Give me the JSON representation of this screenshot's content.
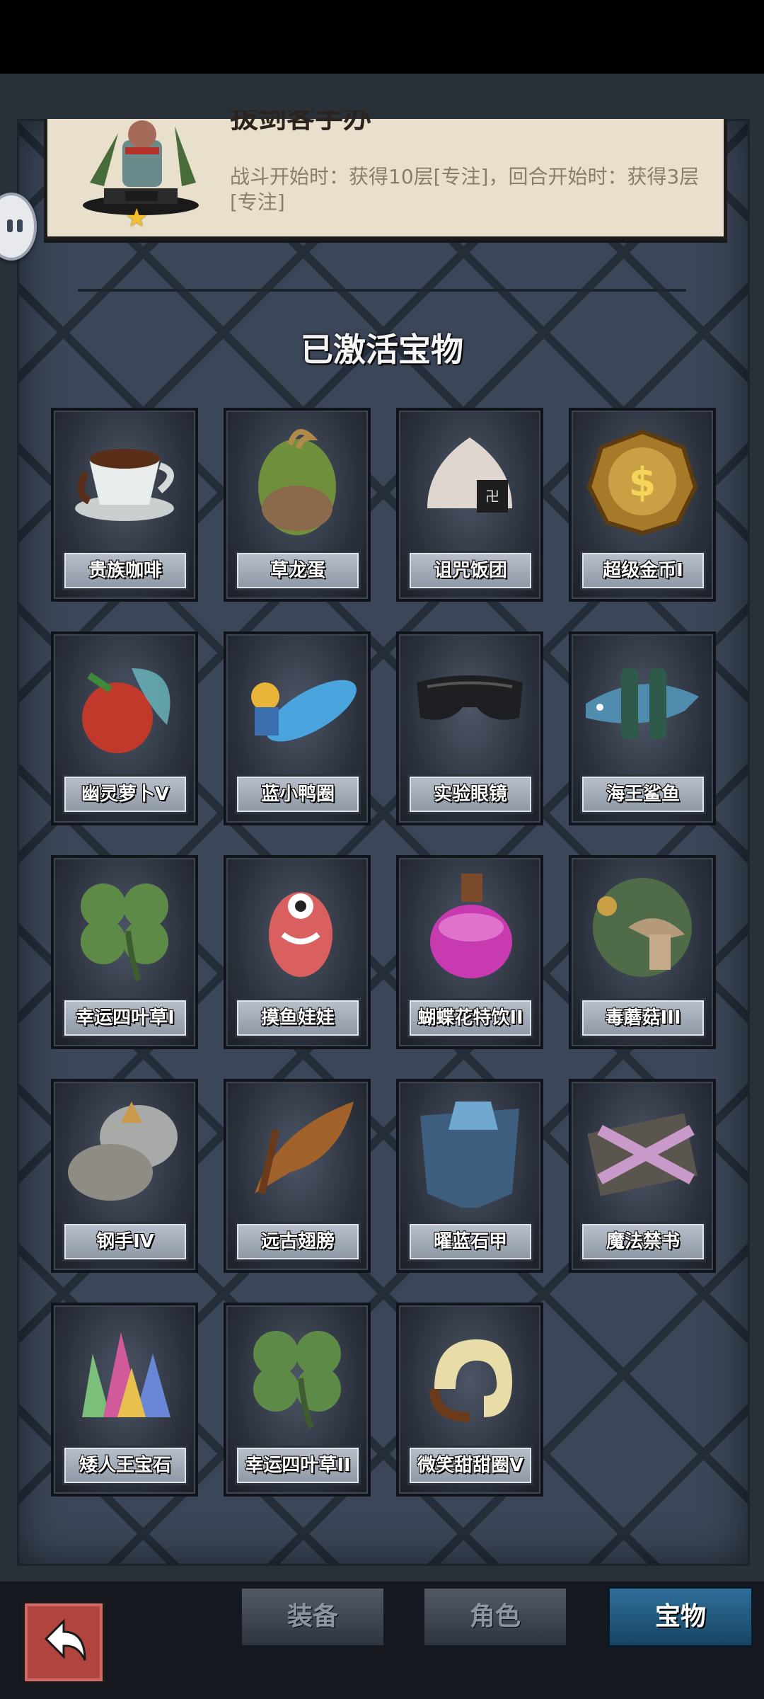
{
  "card": {
    "title": "拔剑客手办",
    "description": "战斗开始时：获得10层[专注]，回合开始时：获得3层[专注]"
  },
  "section_title": "已激活宝物",
  "treasures": [
    {
      "name": "贵族咖啡",
      "icon": "coffee-cup-icon"
    },
    {
      "name": "草龙蛋",
      "icon": "dragon-egg-icon"
    },
    {
      "name": "诅咒饭团",
      "icon": "rice-ball-icon"
    },
    {
      "name": "超级金币I",
      "icon": "gold-coin-icon"
    },
    {
      "name": "幽灵萝卜V",
      "icon": "ghost-radish-icon"
    },
    {
      "name": "蓝小鸭圈",
      "icon": "duck-ring-icon"
    },
    {
      "name": "实验眼镜",
      "icon": "goggles-icon"
    },
    {
      "name": "海王鲨鱼",
      "icon": "shark-icon"
    },
    {
      "name": "幸运四叶草I",
      "icon": "clover-icon"
    },
    {
      "name": "摸鱼娃娃",
      "icon": "doll-icon"
    },
    {
      "name": "蝴蝶花特饮II",
      "icon": "potion-icon"
    },
    {
      "name": "毒蘑菇III",
      "icon": "mushroom-icon"
    },
    {
      "name": "钢手IV",
      "icon": "steel-gauntlet-icon"
    },
    {
      "name": "远古翅膀",
      "icon": "wing-icon"
    },
    {
      "name": "曜蓝石甲",
      "icon": "armor-icon"
    },
    {
      "name": "魔法禁书",
      "icon": "spellbook-icon"
    },
    {
      "name": "矮人王宝石",
      "icon": "gems-icon"
    },
    {
      "name": "幸运四叶草II",
      "icon": "clover-icon"
    },
    {
      "name": "微笑甜甜圈V",
      "icon": "donut-icon"
    }
  ],
  "tabs": [
    {
      "label": "装备",
      "active": false
    },
    {
      "label": "角色",
      "active": false
    },
    {
      "label": "宝物",
      "active": true
    }
  ],
  "colors": {
    "board": "#3b4658",
    "active_tab": "#2e6f9a",
    "back_button": "#b0453f"
  }
}
